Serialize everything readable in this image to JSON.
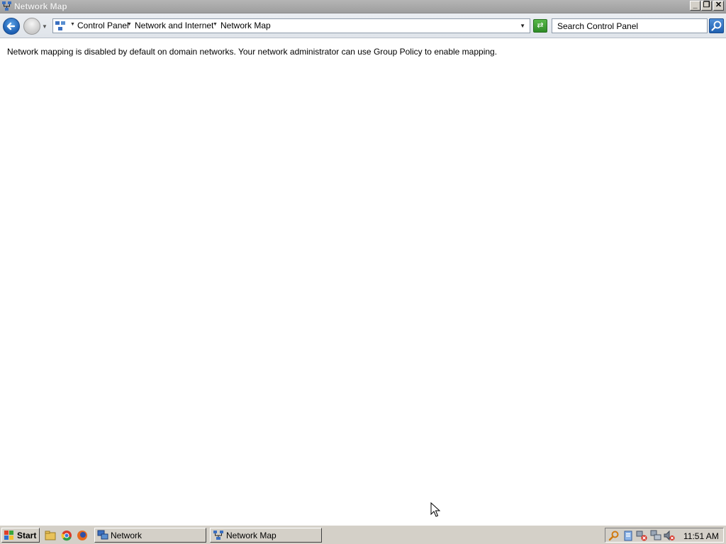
{
  "window": {
    "title": "Network Map",
    "minimize": "_",
    "restore": "❐",
    "close": "✕"
  },
  "address_bar": {
    "breadcrumbs": [
      "Control Panel",
      "Network and Internet",
      "Network Map"
    ],
    "search_placeholder": "Search Control Panel"
  },
  "content": {
    "message": "Network mapping is disabled by default on domain networks. Your network administrator can use Group Policy to enable mapping."
  },
  "taskbar": {
    "start_label": "Start",
    "quick_launch": [
      "file-manager-icon",
      "chrome-icon",
      "firefox-icon"
    ],
    "tasks": [
      {
        "label": "Network",
        "icon": "network-icon"
      },
      {
        "label": "Network Map",
        "icon": "network-map-icon"
      }
    ],
    "tray_icons": [
      "search-icon",
      "clipboard-icon",
      "network-error-icon",
      "network-connections-icon",
      "volume-muted-icon"
    ],
    "clock": "11:51 AM"
  }
}
